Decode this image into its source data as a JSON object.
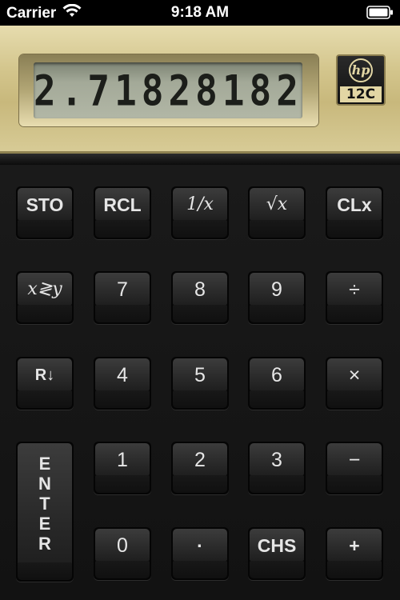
{
  "status_bar": {
    "carrier": "Carrier",
    "time": "9:18 AM"
  },
  "display": {
    "value": "2.718281828",
    "brand": "hp",
    "model": "12C"
  },
  "keys": {
    "sto": "STO",
    "rcl": "RCL",
    "reciprocal": "1/x",
    "sqrt": "√x",
    "clx": "CLx",
    "swap": "x≷y",
    "seven": "7",
    "eight": "8",
    "nine": "9",
    "divide": "÷",
    "roll_down": "R↓",
    "four": "4",
    "five": "5",
    "six": "6",
    "multiply": "×",
    "enter": [
      "E",
      "N",
      "T",
      "E",
      "R"
    ],
    "one": "1",
    "two": "2",
    "three": "3",
    "minus": "−",
    "zero": "0",
    "dot": "·",
    "chs": "CHS",
    "plus": "+"
  },
  "colors": {
    "gold_panel": "#d3c58c",
    "lcd": "#a3a998",
    "key_face": "#333333",
    "key_text": "#e6e6e6"
  }
}
